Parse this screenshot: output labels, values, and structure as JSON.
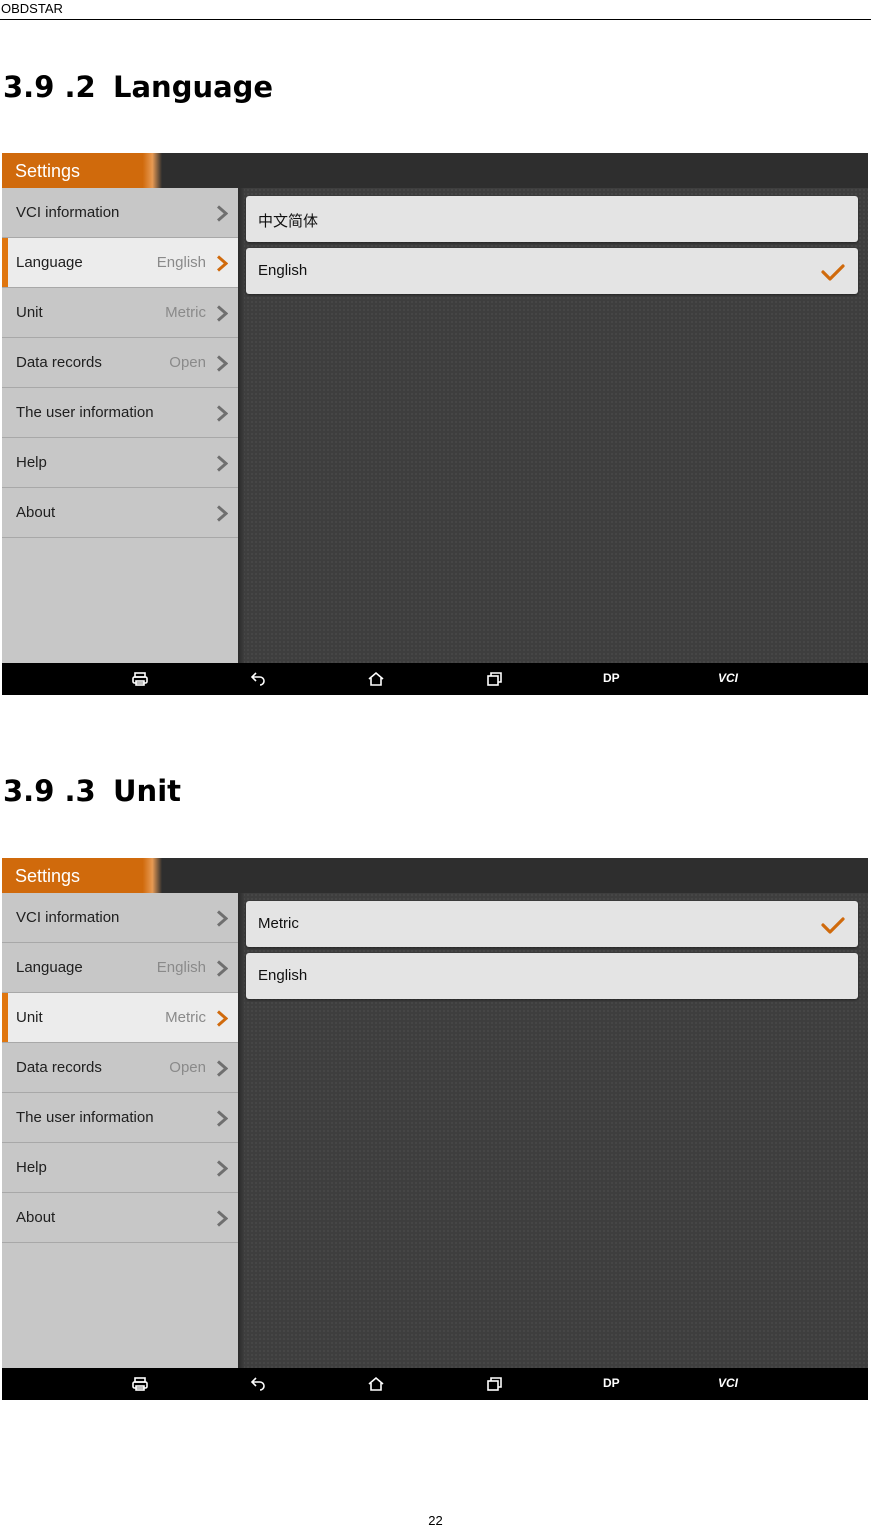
{
  "page_header": "OBDSTAR",
  "page_number": "22",
  "sections": [
    {
      "number": "3.9 .2",
      "title": "Language",
      "screen": {
        "title": "Settings",
        "sidebar": [
          {
            "label": "VCI information",
            "value": ""
          },
          {
            "label": "Language",
            "value": "English",
            "active": true
          },
          {
            "label": "Unit",
            "value": "Metric"
          },
          {
            "label": "Data records",
            "value": "Open"
          },
          {
            "label": "The user information",
            "value": ""
          },
          {
            "label": "Help",
            "value": ""
          },
          {
            "label": "About",
            "value": ""
          }
        ],
        "options": [
          {
            "label": "中文简体",
            "selected": false
          },
          {
            "label": "English",
            "selected": true
          }
        ]
      }
    },
    {
      "number": "3.9 .3",
      "title": "Unit",
      "screen": {
        "title": "Settings",
        "sidebar": [
          {
            "label": "VCI information",
            "value": ""
          },
          {
            "label": "Language",
            "value": "English"
          },
          {
            "label": "Unit",
            "value": "Metric",
            "active": true
          },
          {
            "label": "Data records",
            "value": "Open"
          },
          {
            "label": "The user information",
            "value": ""
          },
          {
            "label": "Help",
            "value": ""
          },
          {
            "label": "About",
            "value": ""
          }
        ],
        "options": [
          {
            "label": "Metric",
            "selected": true
          },
          {
            "label": "English",
            "selected": false
          }
        ]
      }
    }
  ],
  "navbar": {
    "dp_label": "DP",
    "vci_label": "VCI",
    "icons": [
      "printer-icon",
      "back-icon",
      "home-icon",
      "recent-apps-icon"
    ]
  },
  "colors": {
    "accent": "#d06a0c",
    "sidebar": "#c7c7c7",
    "content_bg": "#3e3e3e",
    "navbar": "#000000"
  }
}
